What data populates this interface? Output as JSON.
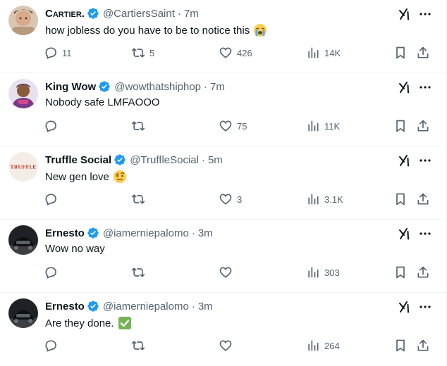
{
  "colors": {
    "verified": "#1d9bf0",
    "muted": "#536471",
    "text": "#0f1419",
    "divider": "#eff3f4"
  },
  "tweets": [
    {
      "name": "Cartier.",
      "handle": "@CartiersSaint",
      "separator": "·",
      "time": "7m",
      "text": "how jobless do you have to be to notice this",
      "emoji": "loudly-crying-face",
      "replies": "11",
      "retweets": "5",
      "likes": "426",
      "views": "14K"
    },
    {
      "name": "King Wow",
      "handle": "@wowthatshiphop",
      "separator": "·",
      "time": "7m",
      "text": "Nobody safe LMFAOOO",
      "emoji": "",
      "replies": "",
      "retweets": "",
      "likes": "75",
      "views": "11K"
    },
    {
      "name": "Truffle Social",
      "handle": "@TruffleSocial",
      "separator": "·",
      "time": "5m",
      "text": "New gen love",
      "emoji": "face-with-raised-eyebrow",
      "avatar_text": "TRUFFLE",
      "replies": "",
      "retweets": "",
      "likes": "3",
      "views": "3.1K"
    },
    {
      "name": "Ernesto",
      "handle": "@iamerniepalomo",
      "separator": "·",
      "time": "3m",
      "text": "Wow no way",
      "emoji": "",
      "replies": "",
      "retweets": "",
      "likes": "",
      "views": "303"
    },
    {
      "name": "Ernesto",
      "handle": "@iamerniepalomo",
      "separator": "·",
      "time": "3m",
      "text": "Are they done.",
      "emoji": "check-mark-button",
      "replies": "",
      "retweets": "",
      "likes": "",
      "views": "264"
    }
  ]
}
